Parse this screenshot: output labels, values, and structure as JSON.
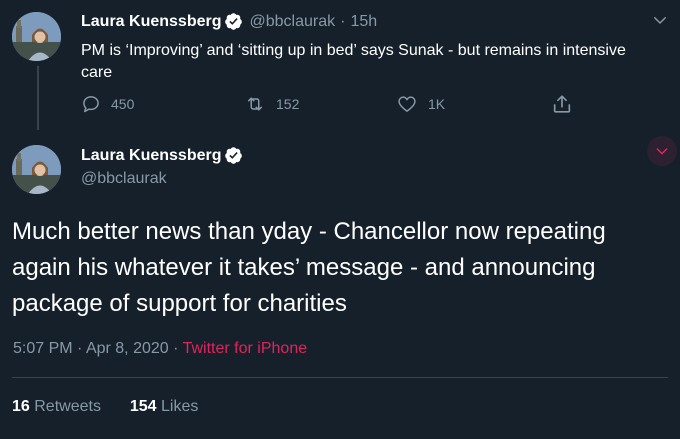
{
  "colors": {
    "background": "#15202b",
    "secondary_text": "#8899a6",
    "accent": "#e0245e",
    "divider": "#38444d"
  },
  "reply_tweet": {
    "author_name": "Laura Kuenssberg",
    "handle": "@bbclaurak",
    "separator": "·",
    "age": "15h",
    "text": "PM is ‘Improving’ and ‘sitting up in bed’ says Sunak - but remains in intensive care",
    "actions": {
      "reply_count": "450",
      "retweet_count": "152",
      "like_count": "1K"
    },
    "icons": [
      "verified-badge-icon",
      "chevron-down-icon",
      "reply-icon",
      "retweet-icon",
      "like-icon",
      "share-icon"
    ]
  },
  "main_tweet": {
    "author_name": "Laura Kuenssberg",
    "handle": "@bbclaurak",
    "text": "Much better news than yday - Chancellor now repeating again his whatever it takes’ message - and announcing package of support for charities",
    "time": "5:07 PM",
    "date": "Apr 8, 2020",
    "separator": "·",
    "source": "Twitter for iPhone",
    "retweets": "16",
    "retweets_label": "Retweets",
    "likes": "154",
    "likes_label": "Likes",
    "icons": [
      "verified-badge-icon",
      "chevron-down-icon"
    ]
  }
}
